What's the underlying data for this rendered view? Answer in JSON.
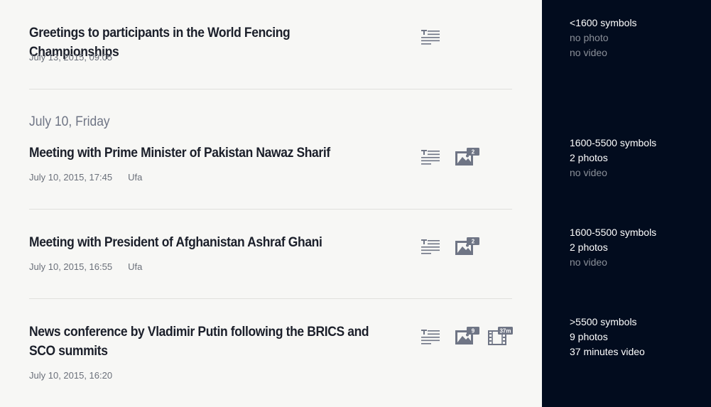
{
  "entries": [
    {
      "title": "Greetings to participants in the World Fencing Championships",
      "datetime": "July 13, 2015, 09:05",
      "place": "",
      "photo_count": "",
      "video_length": "",
      "side": {
        "text": "<1600 symbols",
        "photos": "no photo",
        "video": "no video"
      }
    },
    {
      "title": "Meeting with Prime Minister of Pakistan Nawaz Sharif",
      "datetime": "July 10, 2015, 17:45",
      "place": "Ufa",
      "photo_count": "2",
      "video_length": "",
      "side": {
        "text": "1600-5500 symbols",
        "photos": "2 photos",
        "video": "no video"
      }
    },
    {
      "title": "Meeting with President of Afghanistan Ashraf Ghani",
      "datetime": "July 10, 2015, 16:55",
      "place": "Ufa",
      "photo_count": "2",
      "video_length": "",
      "side": {
        "text": "1600-5500 symbols",
        "photos": "2 photos",
        "video": "no video"
      }
    },
    {
      "title": "News conference by Vladimir Putin following the BRICS and SCO summits",
      "datetime": "July 10, 2015, 16:20",
      "place": "",
      "photo_count": "9",
      "video_length": "37m",
      "side": {
        "text": ">5500 symbols",
        "photos": "9 photos",
        "video": "37 minutes video"
      }
    }
  ],
  "date_heading": "July 10, Friday",
  "icons": {
    "text": "text-icon",
    "photo": "photo-icon",
    "video": "video-icon"
  },
  "colors": {
    "sidebar_bg": "#020c1e",
    "icon": "#6f7585",
    "page_bg": "#f7f7f5"
  }
}
